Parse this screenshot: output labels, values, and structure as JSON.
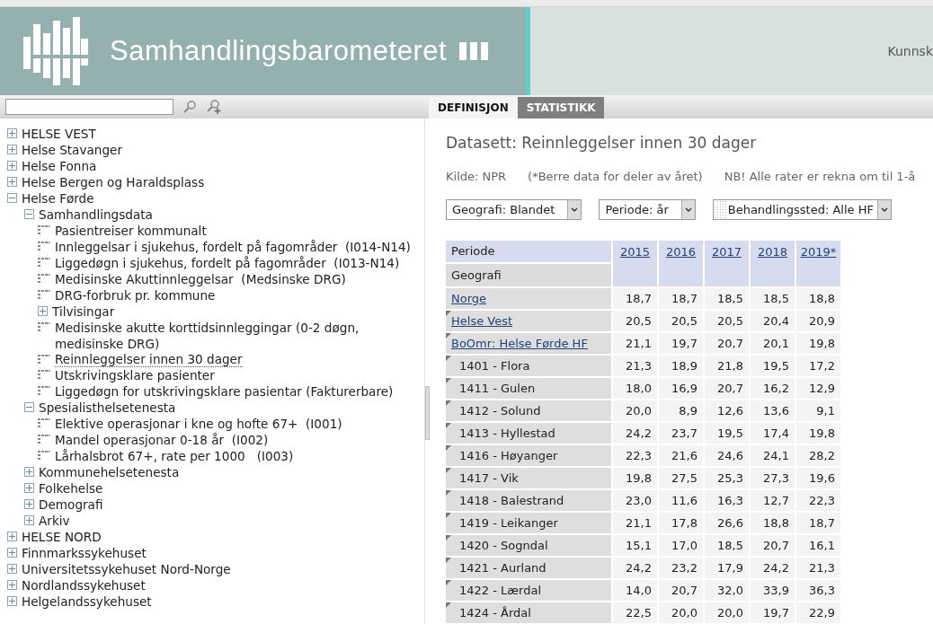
{
  "header": {
    "title": "Samhandlingsbarometeret",
    "right_text": "Kunnsk"
  },
  "tabs": [
    {
      "label": "DEFINISJON",
      "selected": true
    },
    {
      "label": "STATISTIKK",
      "selected": false
    }
  ],
  "tree": [
    {
      "kind": "folder",
      "label": "HELSE VEST",
      "expanded": false
    },
    {
      "kind": "folder",
      "label": "Helse Stavanger",
      "expanded": false
    },
    {
      "kind": "folder",
      "label": "Helse Fonna",
      "expanded": false
    },
    {
      "kind": "folder",
      "label": "Helse Bergen og Haraldsplass",
      "expanded": false
    },
    {
      "kind": "folder",
      "label": "Helse Førde",
      "expanded": true,
      "children": [
        {
          "kind": "folder",
          "label": "Samhandlingsdata",
          "expanded": true,
          "children": [
            {
              "kind": "dataset",
              "label": "Pasientreiser kommunalt",
              "selected": false
            },
            {
              "kind": "dataset",
              "label": "Innleggelsar i sjukehus, fordelt på fagområder  (I014-N14)",
              "selected": false
            },
            {
              "kind": "dataset",
              "label": "Liggedøgn i sjukehus, fordelt på fagområder  (I013-N14)",
              "selected": false
            },
            {
              "kind": "dataset",
              "label": "Medisinske Akuttinnleggelsar  (Medsinske DRG)",
              "selected": false
            },
            {
              "kind": "dataset",
              "label": "DRG-forbruk pr. kommune",
              "selected": false
            },
            {
              "kind": "folder",
              "label": "Tilvisingar",
              "expanded": false
            },
            {
              "kind": "dataset",
              "label": "Medisinske akutte korttidsinnleggingar (0-2 døgn, medisinske DRG)",
              "selected": false
            },
            {
              "kind": "dataset",
              "label": "Reinnleggelser innen 30 dager",
              "selected": true
            },
            {
              "kind": "dataset",
              "label": "Utskrivingsklare pasienter",
              "selected": false
            },
            {
              "kind": "dataset",
              "label": "Liggedøgn for utskrivingsklare pasientar (Fakturerbare)",
              "selected": false
            }
          ]
        },
        {
          "kind": "folder",
          "label": "Spesialisthelsetenesta",
          "expanded": true,
          "children": [
            {
              "kind": "dataset",
              "label": "Elektive operasjonar i kne og hofte 67+  (I001)",
              "selected": false
            },
            {
              "kind": "dataset",
              "label": "Mandel operasjonar 0-18 år  (I002)",
              "selected": false
            },
            {
              "kind": "dataset",
              "label": "Lårhalsbrot 67+, rate per 1000   (I003)",
              "selected": false
            }
          ]
        },
        {
          "kind": "folder",
          "label": "Kommunehelsetenesta",
          "expanded": false
        },
        {
          "kind": "folder",
          "label": "Folkehelse",
          "expanded": false
        },
        {
          "kind": "folder",
          "label": "Demografi",
          "expanded": false
        },
        {
          "kind": "folder",
          "label": "Arkiv",
          "expanded": false
        }
      ]
    },
    {
      "kind": "folder",
      "label": "HELSE NORD",
      "expanded": false
    },
    {
      "kind": "folder",
      "label": "Finnmarkssykehuset",
      "expanded": false
    },
    {
      "kind": "folder",
      "label": "Universitetssykehuset Nord-Norge",
      "expanded": false
    },
    {
      "kind": "folder",
      "label": "Nordlandssykehuset",
      "expanded": false
    },
    {
      "kind": "folder",
      "label": "Helgelandssykehuset",
      "expanded": false
    }
  ],
  "dataset_title": "Datasett: Reinnleggelser innen 30 dager",
  "notes": [
    "Kilde: NPR",
    "(*Berre data for deler av året)",
    "NB! Alle rater er rekna om til 1-å"
  ],
  "dropdowns": [
    {
      "label": "Geografi: Blandet",
      "patterned": false
    },
    {
      "label": "Periode: år",
      "patterned": false
    },
    {
      "label": "Behandlingssted: Alle HF",
      "patterned": true
    }
  ],
  "table": {
    "period_label": "Periode",
    "geo_label": "Geografi",
    "columns": [
      "2015",
      "2016",
      "2017",
      "2018",
      "2019*"
    ],
    "rows": [
      {
        "name": "Norge",
        "link": true,
        "marker": false,
        "values": [
          "18,7",
          "18,7",
          "18,5",
          "18,5",
          "18,8"
        ]
      },
      {
        "name": "Helse Vest",
        "link": true,
        "marker": true,
        "values": [
          "20,5",
          "20,5",
          "20,5",
          "20,4",
          "20,9"
        ]
      },
      {
        "name": "BoOmr: Helse Førde HF",
        "link": true,
        "marker": true,
        "values": [
          "21,1",
          "19,7",
          "20,7",
          "20,1",
          "19,8"
        ]
      },
      {
        "name": "1401 - Flora",
        "link": false,
        "marker": true,
        "values": [
          "21,3",
          "18,9",
          "21,8",
          "19,5",
          "17,2"
        ]
      },
      {
        "name": "1411 - Gulen",
        "link": false,
        "marker": true,
        "values": [
          "18,0",
          "16,9",
          "20,7",
          "16,2",
          "12,9"
        ]
      },
      {
        "name": "1412 - Solund",
        "link": false,
        "marker": true,
        "values": [
          "20,0",
          "8,9",
          "12,6",
          "13,6",
          "9,1"
        ]
      },
      {
        "name": "1413 - Hyllestad",
        "link": false,
        "marker": true,
        "values": [
          "24,2",
          "23,7",
          "19,5",
          "17,4",
          "19,8"
        ]
      },
      {
        "name": "1416 - Høyanger",
        "link": false,
        "marker": true,
        "values": [
          "22,3",
          "21,6",
          "24,6",
          "24,1",
          "28,2"
        ]
      },
      {
        "name": "1417 - Vik",
        "link": false,
        "marker": true,
        "values": [
          "19,8",
          "27,5",
          "25,3",
          "27,3",
          "19,6"
        ]
      },
      {
        "name": "1418 - Balestrand",
        "link": false,
        "marker": true,
        "values": [
          "23,0",
          "11,6",
          "16,3",
          "12,7",
          "22,3"
        ]
      },
      {
        "name": "1419 - Leikanger",
        "link": false,
        "marker": true,
        "values": [
          "21,1",
          "17,8",
          "26,6",
          "18,8",
          "18,7"
        ]
      },
      {
        "name": "1420 - Sogndal",
        "link": false,
        "marker": true,
        "values": [
          "15,1",
          "17,0",
          "18,5",
          "20,7",
          "16,1"
        ]
      },
      {
        "name": "1421 - Aurland",
        "link": false,
        "marker": true,
        "values": [
          "24,2",
          "23,2",
          "17,9",
          "24,2",
          "21,3"
        ]
      },
      {
        "name": "1422 - Lærdal",
        "link": false,
        "marker": true,
        "values": [
          "14,0",
          "20,7",
          "32,0",
          "33,9",
          "36,3"
        ]
      },
      {
        "name": "1424 - Årdal",
        "link": false,
        "marker": true,
        "values": [
          "22,5",
          "20,0",
          "20,0",
          "19,7",
          "22,9"
        ]
      }
    ]
  }
}
